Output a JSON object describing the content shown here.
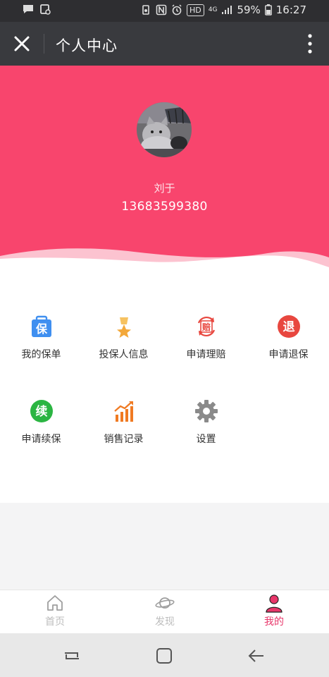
{
  "status_bar": {
    "hd": "HD",
    "network": "4G",
    "battery": "59%",
    "time": "16:27"
  },
  "header": {
    "title": "个人中心"
  },
  "profile": {
    "name": "刘于",
    "phone": "13683599380"
  },
  "menu": [
    {
      "label": "我的保单",
      "icon": "policy-icon",
      "glyph": "保",
      "color": "#3f8ff0"
    },
    {
      "label": "投保人信息",
      "icon": "medal-icon",
      "color": "#f3a83a"
    },
    {
      "label": "申请理赔",
      "icon": "claim-icon",
      "glyph": "赔",
      "color": "#e8473f"
    },
    {
      "label": "申请退保",
      "icon": "cancel-icon",
      "glyph": "退",
      "color": "#e8473f"
    },
    {
      "label": "申请续保",
      "icon": "renew-icon",
      "glyph": "续",
      "color": "#2bb542"
    },
    {
      "label": "销售记录",
      "icon": "chart-icon",
      "color": "#f07a22"
    },
    {
      "label": "设置",
      "icon": "gear-icon",
      "color": "#8a8a8a"
    }
  ],
  "tabs": [
    {
      "label": "首页",
      "icon": "home-icon",
      "active": false
    },
    {
      "label": "发现",
      "icon": "planet-icon",
      "active": false
    },
    {
      "label": "我的",
      "icon": "user-icon",
      "active": true
    }
  ],
  "colors": {
    "accent": "#f8456d",
    "active_tab": "#e8366a",
    "header_bg": "#393a3e"
  }
}
